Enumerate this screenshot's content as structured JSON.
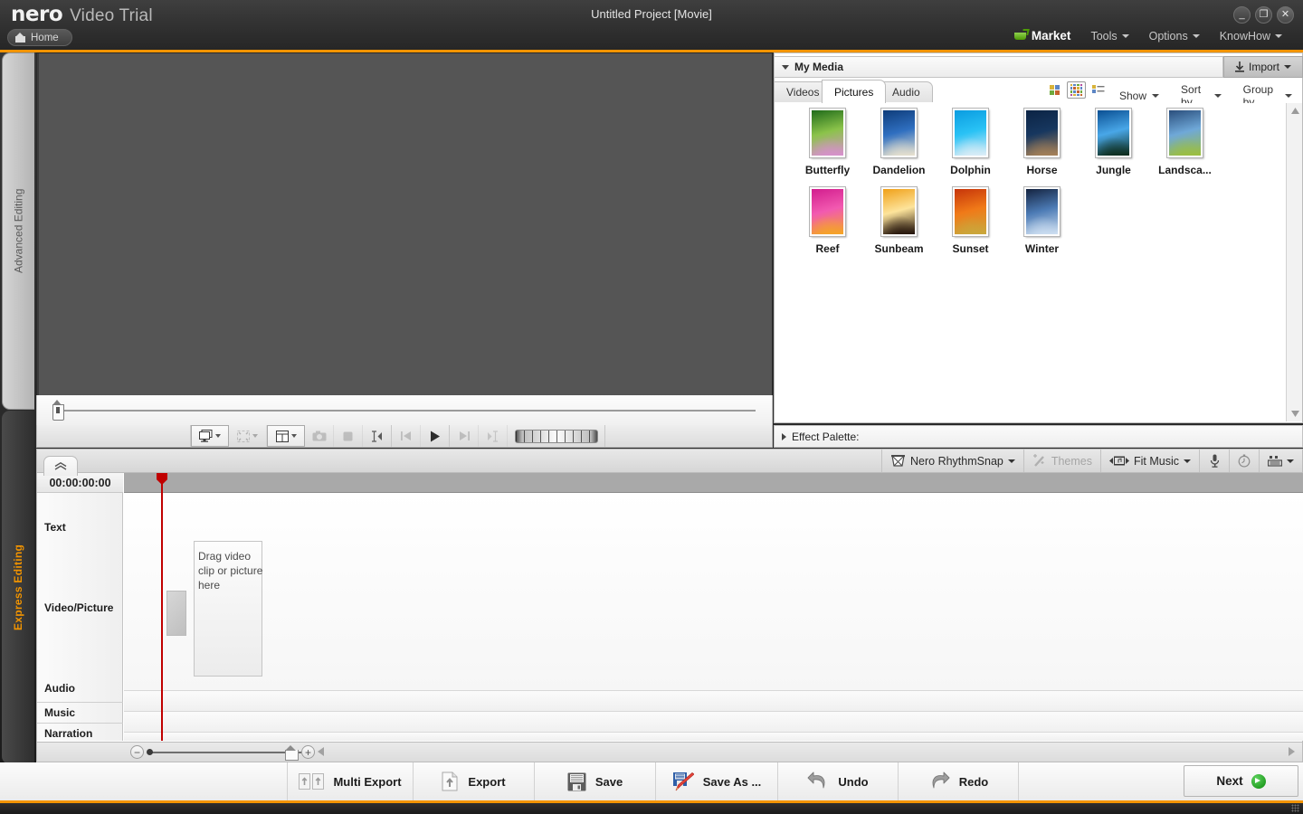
{
  "titlebar": {
    "brand_name": "nero",
    "brand_product": "Video Trial",
    "home_label": "Home",
    "project_title": "Untitled Project [Movie]",
    "minimize": "_",
    "restore": "❐",
    "close": "✕"
  },
  "menubar": {
    "market": "Market",
    "tools": "Tools",
    "options": "Options",
    "knowhow": "KnowHow"
  },
  "vertical_tabs": {
    "advanced": "Advanced Editing",
    "express": "Express Editing",
    "active": "Express Editing",
    "accent_color": "#f29400"
  },
  "transport": {
    "buttons": [
      {
        "name": "display-mode",
        "icon": "monitor-icon",
        "dropdown": true,
        "enabled": true
      },
      {
        "name": "fullscreen",
        "icon": "fullscreen-icon",
        "dropdown": true,
        "enabled": false
      },
      {
        "name": "view-layout",
        "icon": "layout-icon",
        "dropdown": true,
        "enabled": true
      },
      {
        "name": "snapshot",
        "icon": "camera-icon",
        "dropdown": false,
        "enabled": false
      },
      {
        "name": "stop",
        "icon": "stop-icon",
        "dropdown": false,
        "enabled": false
      },
      {
        "name": "mark-in",
        "icon": "mark-in-icon",
        "dropdown": false,
        "enabled": true
      },
      {
        "name": "step-back",
        "icon": "step-back-icon",
        "dropdown": false,
        "enabled": false
      },
      {
        "name": "play",
        "icon": "play-icon",
        "dropdown": false,
        "enabled": true
      },
      {
        "name": "step-forward",
        "icon": "step-forward-icon",
        "dropdown": false,
        "enabled": false
      },
      {
        "name": "mark-out",
        "icon": "mark-out-icon",
        "dropdown": false,
        "enabled": false
      },
      {
        "name": "jog-shuttle",
        "icon": "jog-shuttle-icon",
        "dropdown": false,
        "enabled": true
      }
    ]
  },
  "media_panel": {
    "header_title": "My Media",
    "import_label": "Import",
    "tabs": [
      {
        "label": "Videos",
        "active": false
      },
      {
        "label": "Pictures",
        "active": true
      },
      {
        "label": "Audio",
        "active": false
      }
    ],
    "view_modes": [
      {
        "name": "large-icons-view",
        "active": false
      },
      {
        "name": "grid-view",
        "active": true
      },
      {
        "name": "details-view",
        "active": false
      }
    ],
    "options": [
      {
        "label": "Show"
      },
      {
        "label": "Sort by"
      },
      {
        "label": "Group by"
      }
    ],
    "items": [
      {
        "label": "Butterfly",
        "c1": "#1f6b1a",
        "c2": "#8bc34a",
        "c3": "#d98fd0"
      },
      {
        "label": "Dandelion",
        "c1": "#0e3c7a",
        "c2": "#2f6fc0",
        "c3": "#eae3cf"
      },
      {
        "label": "Dolphin",
        "c1": "#0a9ce0",
        "c2": "#29c2f5",
        "c3": "#dfeef7"
      },
      {
        "label": "Horse",
        "c1": "#0b2344",
        "c2": "#17375f",
        "c3": "#a88257"
      },
      {
        "label": "Jungle",
        "c1": "#0a4f93",
        "c2": "#49a7e8",
        "c3": "#0c2a18"
      },
      {
        "label": "Landsca...",
        "c1": "#2a4e7c",
        "c2": "#6fa8d8",
        "c3": "#9dbf3a"
      },
      {
        "label": "Reef",
        "c1": "#d21d8e",
        "c2": "#f25ab0",
        "c3": "#f5a623"
      },
      {
        "label": "Sunbeam",
        "c1": "#f0a018",
        "c2": "#fde49b",
        "c3": "#201008"
      },
      {
        "label": "Sunset",
        "c1": "#c6340a",
        "c2": "#f07a18",
        "c3": "#c9a83c"
      },
      {
        "label": "Winter",
        "c1": "#14233f",
        "c2": "#4c7bb5",
        "c3": "#cfe0f2"
      }
    ]
  },
  "effect_palette": {
    "label": "Effect Palette:"
  },
  "timeline_toolbar": {
    "buttons": [
      {
        "label": "Nero RhythmSnap",
        "icon": "drum-icon",
        "dropdown": true,
        "enabled": true
      },
      {
        "label": "Themes",
        "icon": "magic-wand-icon",
        "dropdown": false,
        "enabled": false
      },
      {
        "label": "Fit Music",
        "icon": "fit-music-icon",
        "dropdown": true,
        "enabled": true
      },
      {
        "label": "",
        "icon": "microphone-icon",
        "dropdown": false,
        "enabled": true
      },
      {
        "label": "",
        "icon": "stopwatch-icon",
        "dropdown": false,
        "enabled": true
      },
      {
        "label": "",
        "icon": "keyboard-icon",
        "dropdown": true,
        "enabled": true
      }
    ]
  },
  "timeline": {
    "timecode": "00:00:00:00",
    "tracks": [
      {
        "label": "Text"
      },
      {
        "label": "Video/Picture"
      },
      {
        "label": "Audio"
      },
      {
        "label": "Music"
      },
      {
        "label": "Narration"
      }
    ],
    "drop_hint": "Drag video clip or picture here",
    "zoom_minus": "−",
    "zoom_plus": "+"
  },
  "actionbar": {
    "buttons": [
      {
        "label": "Multi Export",
        "icon": "multi-export-icon"
      },
      {
        "label": "Export",
        "icon": "export-icon"
      },
      {
        "label": "Save",
        "icon": "floppy-icon"
      },
      {
        "label": "Save As ...",
        "icon": "save-as-icon"
      },
      {
        "label": "Undo",
        "icon": "undo-icon"
      },
      {
        "label": "Redo",
        "icon": "redo-icon"
      }
    ],
    "next_label": "Next"
  }
}
